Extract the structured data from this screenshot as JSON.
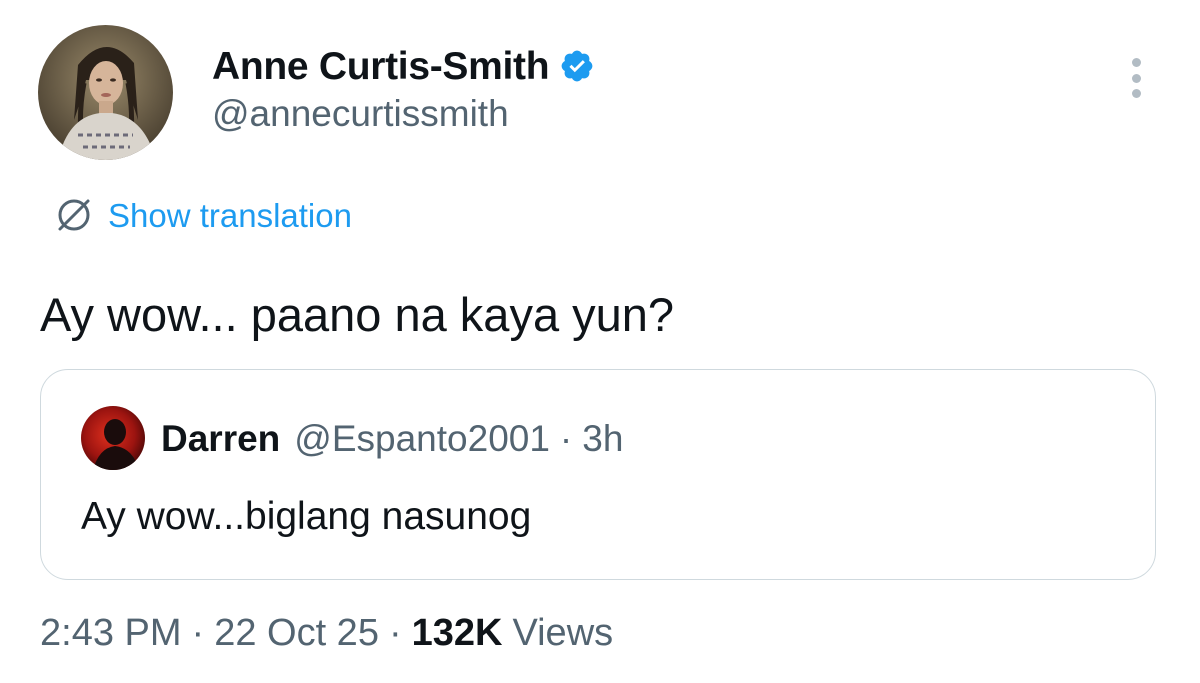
{
  "author": {
    "display_name": "Anne Curtis-Smith",
    "handle": "@annecurtissmith",
    "verified": true,
    "avatar_icon": "profile-photo"
  },
  "translate": {
    "label": "Show translation",
    "icon": "globe-icon"
  },
  "tweet": {
    "text": "Ay wow... paano na kaya yun?"
  },
  "quote": {
    "display_name": "Darren",
    "handle": "@Espanto2001",
    "separator": "·",
    "time": "3h",
    "text": "Ay wow...biglang nasunog"
  },
  "meta": {
    "time": "2:43 PM",
    "separator": "·",
    "date": "22 Oct 25",
    "views_count": "132K",
    "views_label": "Views"
  },
  "colors": {
    "accent": "#1d9bf0",
    "text_primary": "#0f1419",
    "text_secondary": "#536471",
    "border": "#cfd9de"
  }
}
